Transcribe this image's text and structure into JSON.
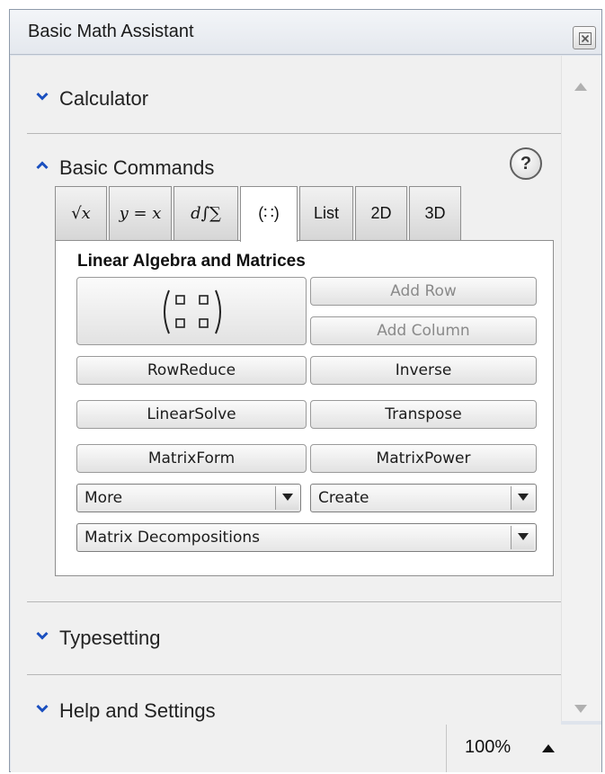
{
  "window": {
    "title": "Basic Math Assistant"
  },
  "sections": {
    "calculator": "Calculator",
    "basic_commands": "Basic Commands",
    "typesetting": "Typesetting",
    "help_settings": "Help and Settings"
  },
  "help": {
    "label": "?"
  },
  "tabs": [
    {
      "label": "√x",
      "active": false
    },
    {
      "label": "y = x",
      "active": false
    },
    {
      "label": "d∫∑",
      "active": false
    },
    {
      "label": "(∷)",
      "active": true
    },
    {
      "label": "List",
      "active": false
    },
    {
      "label": "2D",
      "active": false
    },
    {
      "label": "3D",
      "active": false
    }
  ],
  "content": {
    "title": "Linear Algebra and Matrices",
    "buttons": {
      "add_row": "Add Row",
      "add_column": "Add Column",
      "row_reduce": "RowReduce",
      "inverse": "Inverse",
      "linear_solve": "LinearSolve",
      "transpose": "Transpose",
      "matrix_form": "MatrixForm",
      "matrix_power": "MatrixPower"
    },
    "dropdowns": {
      "more": "More",
      "create": "Create",
      "decompositions": "Matrix Decompositions"
    }
  },
  "status": {
    "zoom": "100%"
  }
}
